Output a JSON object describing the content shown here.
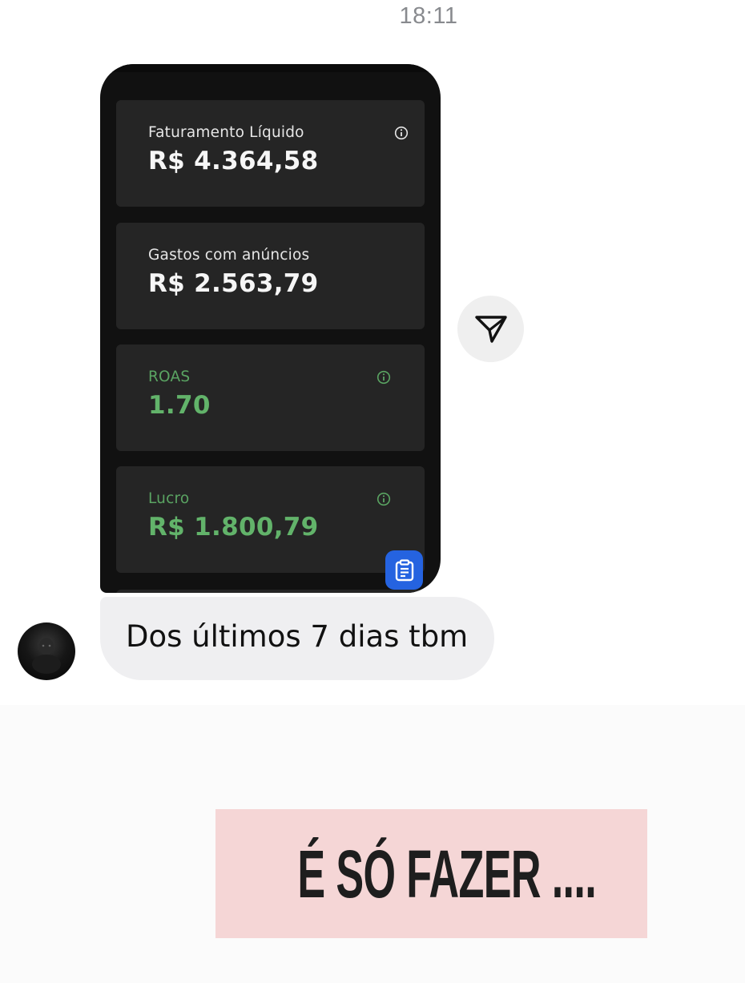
{
  "chat": {
    "timestamp": "18:11",
    "shared_image": {
      "metrics": [
        {
          "label": "Faturamento Líquido",
          "value": "R$ 4.364,58",
          "info_icon": "info-icon"
        },
        {
          "label": "Gastos com anúncios",
          "value": "R$ 2.563,79"
        },
        {
          "label": "ROAS",
          "value": "1.70",
          "info_icon": "info-icon"
        },
        {
          "label": "Lucro",
          "value": "R$ 1.800,79",
          "info_icon": "info-icon"
        }
      ],
      "floating_button_icon": "clipboard-icon"
    },
    "share_button_icon": "send-icon",
    "message": {
      "sender_avatar": "avatar",
      "text": "Dos últimos 7 dias tbm"
    }
  },
  "overlay": {
    "caption": "É SÓ FAZER ...."
  },
  "colors": {
    "card_dark": "#252525",
    "positive_green": "#62b36a",
    "clipboard_blue": "#2563e0",
    "bubble_gray": "#efeff1",
    "caption_pink": "#f5d6d6"
  }
}
